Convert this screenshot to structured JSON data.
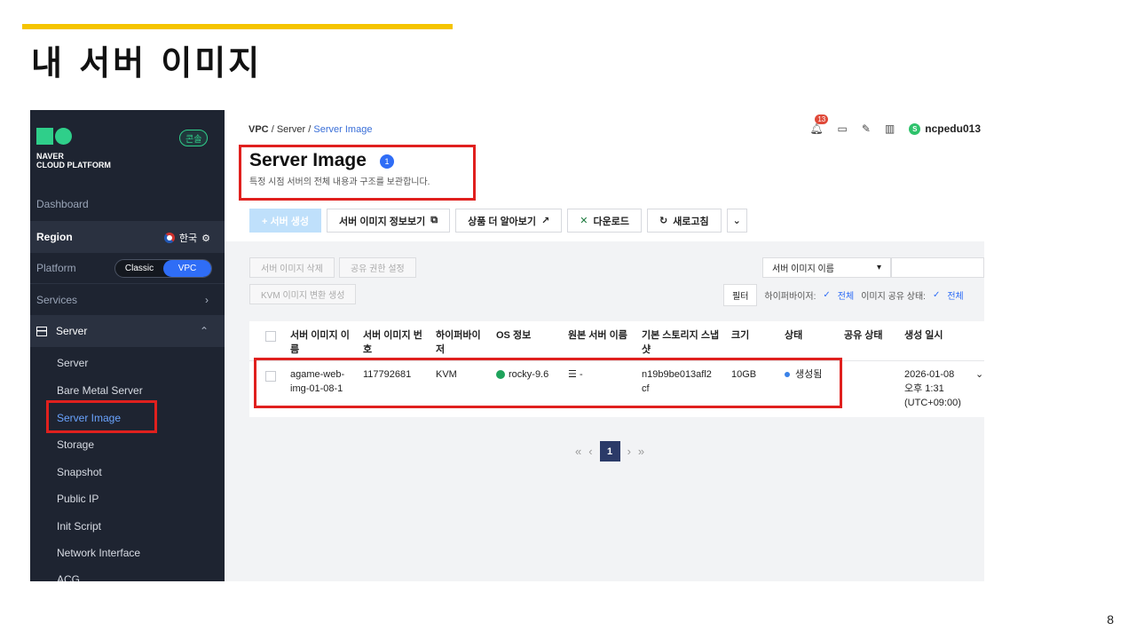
{
  "slide": {
    "title": "내 서버 이미지",
    "page_number": "8"
  },
  "sidebar": {
    "logo_line1": "NAVER",
    "logo_line2": "CLOUD PLATFORM",
    "console_badge": "콘솔",
    "dashboard": "Dashboard",
    "region_label": "Region",
    "region_value": "한국",
    "platform_label": "Platform",
    "platform_classic": "Classic",
    "platform_vpc": "VPC",
    "services": "Services",
    "server_section": "Server",
    "items": [
      {
        "label": "Server"
      },
      {
        "label": "Bare Metal Server"
      },
      {
        "label": "Server Image"
      },
      {
        "label": "Storage"
      },
      {
        "label": "Snapshot"
      },
      {
        "label": "Public IP"
      },
      {
        "label": "Init Script"
      },
      {
        "label": "Network Interface"
      },
      {
        "label": "ACG"
      }
    ]
  },
  "header": {
    "breadcrumb_vpc": "VPC",
    "breadcrumb_server": "Server",
    "breadcrumb_current": "Server Image",
    "sep": "/",
    "notification_count": "13",
    "username": "ncpedu013",
    "user_initial": "S"
  },
  "page": {
    "title": "Server Image",
    "info_count": "1",
    "description": "특정 시점 서버의 전체 내용과 구조를 보관합니다."
  },
  "toolbar": {
    "create": "+ 서버 생성",
    "image_info": "서버 이미지 정보보기",
    "learn_more": "상품 더 알아보기",
    "download": "다운로드",
    "refresh": "새로고침"
  },
  "actions": {
    "delete": "서버 이미지 삭제",
    "share": "공유 권한 설정",
    "kvm_convert": "KVM 이미지 변환 생성",
    "search_select": "서버 이미지 이름",
    "filter": "필터",
    "hypervisor_label": "하이퍼바이저:",
    "hypervisor_value": "전체",
    "share_state_label": "이미지 공유 상태:",
    "share_state_value": "전체"
  },
  "table": {
    "headers": [
      "서버 이미지 이름",
      "서버 이미지 번호",
      "하이퍼바이저",
      "OS 정보",
      "원본 서버 이름",
      "기본 스토리지 스냅샷",
      "크기",
      "상태",
      "공유 상태",
      "생성 일시"
    ],
    "row": {
      "name_l1": "agame-web-",
      "name_l2": "img-01-08-1",
      "number": "117792681",
      "hypervisor": "KVM",
      "os": "rocky-9.6",
      "origin_server": "-",
      "snapshot_l1": "n19b9be013afl2",
      "snapshot_l2": "cf",
      "size": "10GB",
      "status": "생성됨",
      "created_l1": "2026-01-08",
      "created_l2": "오후 1:31",
      "created_l3": "(UTC+09:00)"
    }
  },
  "pagination": {
    "current": "1"
  },
  "colors": {
    "accent_yellow": "#f5c400",
    "highlight_red": "#e0201e",
    "brand_green": "#2fcf8a",
    "link_blue": "#2f6df6",
    "sidebar_bg": "#1e2431"
  }
}
